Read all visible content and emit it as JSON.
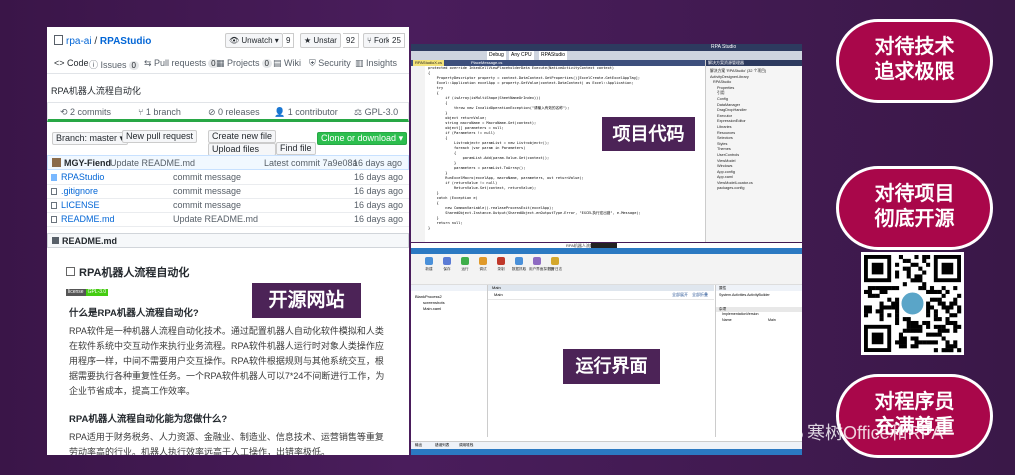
{
  "github": {
    "owner": "rpa-ai",
    "separator": " / ",
    "repo": "RPAStudio",
    "unwatch_label": "Unwatch",
    "unwatch_count": "9",
    "unstar_label": "Unstar",
    "unstar_count": "92",
    "fork_label": "Fork",
    "fork_count": "25",
    "tabs": [
      {
        "label": "Code",
        "count": ""
      },
      {
        "label": "Issues",
        "count": "0"
      },
      {
        "label": "Pull requests",
        "count": "0"
      },
      {
        "label": "Projects",
        "count": "0"
      },
      {
        "label": "Wiki",
        "count": ""
      },
      {
        "label": "Security",
        "count": ""
      },
      {
        "label": "Insights",
        "count": ""
      }
    ],
    "description": "RPA机器人流程自动化",
    "stats": [
      "2 commits",
      "1 branch",
      "0 releases",
      "1 contributor",
      "GPL-3.0"
    ],
    "branch_label": "Branch: master",
    "new_pr_label": "New pull request",
    "create_file_label": "Create new file",
    "upload_files_label": "Upload files",
    "find_file_label": "Find file",
    "clone_label": "Clone or download",
    "latest_author": "MGY-Fiend",
    "latest_message": "Update README.md",
    "latest_commit": "Latest commit 7a9e08a",
    "latest_time": "16 days ago",
    "files": [
      {
        "name": "RPAStudio",
        "message": "commit message",
        "time": "16 days ago",
        "type": "dir"
      },
      {
        "name": ".gitignore",
        "message": "commit message",
        "time": "16 days ago",
        "type": "file"
      },
      {
        "name": "LICENSE",
        "message": "commit message",
        "time": "16 days ago",
        "type": "file"
      },
      {
        "name": "README.md",
        "message": "Update README.md",
        "time": "16 days ago",
        "type": "file"
      }
    ],
    "readme_header": "README.md",
    "readme": {
      "h1": "RPA机器人流程自动化",
      "badge_left": "license",
      "badge_right": "GPL-3.0",
      "h2_1": "什么是RPA机器人流程自动化?",
      "p1": "RPA软件是一种机器人流程自动化技术。通过配置机器人自动化软件模拟和人类在软件系统中交互动作来执行业务流程。RPA软件机器人运行时对象人类操作应用程序一样，中间不需要用户交互操作。RPA软件根据规则与其他系统交互，根据需要执行各种重复性任务。一个RPA软件机器人可以7*24不间断进行工作，为企业节省成本，提高工作效率。",
      "h2_2": "RPA机器人流程自动化能为您做什么?",
      "p2": "RPA适用于财务税务、人力资源、金融业、制造业、信息技术、运营销售等重复劳动率高的行业。机器人执行效率远高于人工操作，出错率极低。"
    }
  },
  "labels": {
    "website": "开源网站",
    "code": "项目代码",
    "runtime": "运行界面"
  },
  "pills": [
    {
      "line1": "对待技术",
      "line2": "追求极限"
    },
    {
      "line1": "对待项目",
      "line2": "彻底开源"
    },
    {
      "line1": "对程序员",
      "line2": "充满尊重"
    }
  ],
  "watermark": "寒树Office和RPA",
  "vs": {
    "title_left": "RPA Studio",
    "config_debug": "Debug",
    "config_cpu": "Any CPU",
    "config_project": "RPAStudio",
    "tab_active": "RPAStudioX.cs",
    "tab_other": "PlaceMessage.cs",
    "solution_title": "解决方案资源管理器",
    "solution_items": [
      "解决方案 'RPAStudio' (32 个项目)",
      "ActivityDesignerLibrary",
      "RPAStudio",
      "Properties",
      "引用",
      "Config",
      "DataManager",
      "DragDropHandler",
      "Executor",
      "ExpressionEditor",
      "Libraries",
      "Resources",
      "Selectors",
      "Styles",
      "Themes",
      "UserControls",
      "ViewModel",
      "Windows",
      "App.config",
      "App.xaml",
      "ViewModelLocator.cs",
      "packages.config"
    ],
    "code_lines": [
      "protected override InkedCellViewPlaceholderData Execute(NativeActivityContext context)",
      "{",
      "    PropertyDescriptor property = context.DataContext.GetProperties()[ExcelCreate.GetExcelAppTag];",
      "    Excel::Application excelApp = property.GetValue(context.DataContext) as Excel::Application;",
      "    try",
      "    {",
      "        if (isArray(isMultiShape(SheetNameOrIndex)))",
      "        {",
      "            throw new InvalidOperationException(\"请输入有效的名称\");",
      "        }",
      "",
      "        object returnValue;",
      "        string macroName = MacroName.Get(context);",
      "        object[] parameters = null;",
      "        if (Parameters != null)",
      "        {",
      "            List<object> paramList = new List<object>();",
      "            foreach (var param in Parameters)",
      "            {",
      "                paramList.Add(param.Value.Get(context));",
      "            }",
      "            parameters = paramList.ToArray();",
      "        }",
      "        RunExcelMacro(excelApp, macroName, parameters, out returnValue);",
      "        if (returnValue != null)",
      "            ReturnValue.Set(context, returnValue);",
      "    }",
      "    catch (Exception e)",
      "    {",
      "        new CommonVariable().realaseProcessExit(excelApp);",
      "        SharedObject.Instance.Output(SharedObject.enOutputType.Error, \"EXCEL执行宏出错\", e.Message);",
      "    }",
      "    return null;",
      "}"
    ]
  },
  "rpa": {
    "window_title": "RPA机器人流程自动化",
    "project_root": "BlankProcess2",
    "project_items": [
      "screenshots",
      "Main.xaml"
    ],
    "doc_tab": "Main",
    "doc_label": "Main",
    "expand_all": "全部展开",
    "collapse_all": "全部折叠",
    "props_title": "属性",
    "props_subtitle": "System.Activities.ActivityBuilder",
    "props_group": "杂项",
    "props_rows": [
      {
        "key": "ImplementationVersion",
        "value": ""
      },
      {
        "key": "Name",
        "value": "Main"
      }
    ],
    "toolbar_labels": [
      "新建",
      "保存",
      "运行",
      "调试",
      "录制",
      "数据抓取",
      "用户界面探测器",
      "打开日志"
    ],
    "bottom_tabs": [
      "输出",
      "错误列表",
      "调用堆栈"
    ]
  },
  "colors": {
    "bg": "#3d174d",
    "pill": "#a9074a",
    "tag": "#42174e",
    "vs_blue": "#2d3a5f",
    "gh_green": "#28a745"
  }
}
